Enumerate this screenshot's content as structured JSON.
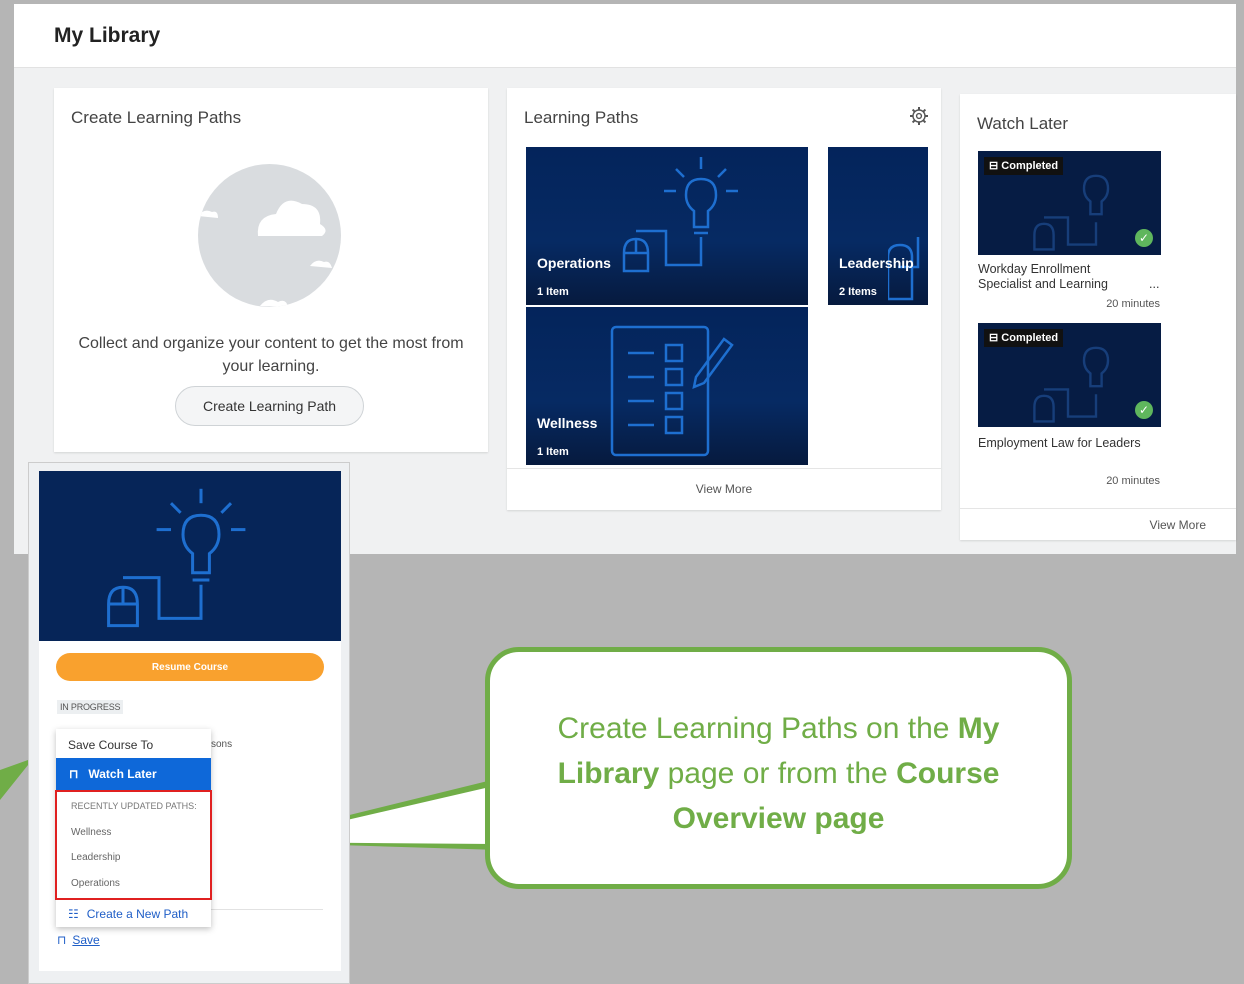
{
  "page": {
    "title": "My Library"
  },
  "create_card": {
    "title": "Create Learning Paths",
    "description": "Collect and organize your content to get the most from your learning.",
    "button_label": "Create Learning Path",
    "icon": "cloud-icon"
  },
  "paths_card": {
    "title": "Learning Paths",
    "settings_icon": "gear-icon",
    "tiles": [
      {
        "name": "Operations",
        "count": "1 Item",
        "art": "lightbulb-mouse-icon"
      },
      {
        "name": "Leadership",
        "count": "2 Items",
        "art": "lightbulb-mouse-icon"
      },
      {
        "name": "Wellness",
        "count": "1 Item",
        "art": "checklist-icon"
      }
    ],
    "view_more": "View More"
  },
  "watch_later": {
    "title": "Watch Later",
    "items": [
      {
        "badge": "Completed",
        "name_line1": "Workday Enrollment",
        "name_line2": "Specialist and Learning",
        "ellipsis": "...",
        "duration": "20 minutes"
      },
      {
        "badge": "Completed",
        "name_line1": "Employment Law for Leaders",
        "name_line2": "",
        "ellipsis": "",
        "duration": "20 minutes"
      }
    ],
    "view_more": "View More"
  },
  "course_panel": {
    "resume_label": "Resume Course",
    "status": "IN PROGRESS",
    "lessons_fragment": "sons",
    "save_label": "Save",
    "dropdown": {
      "heading": "Save Course To",
      "watch_later_label": "Watch Later",
      "section_label": "RECENTLY UPDATED PATHS:",
      "paths": [
        "Wellness",
        "Leadership",
        "Operations"
      ],
      "create_new_label": "Create a New Path"
    }
  },
  "callout": {
    "text_part1": "Create Learning Paths on the ",
    "bold1": "My Library",
    "text_part2": " page or from the ",
    "bold2": "Course Overview page"
  },
  "colors": {
    "accent_blue": "#0e68d9",
    "resume_orange": "#f9a12e",
    "callout_green": "#70ad47",
    "highlight_red": "#e02020",
    "tile_navy": "#062558"
  }
}
